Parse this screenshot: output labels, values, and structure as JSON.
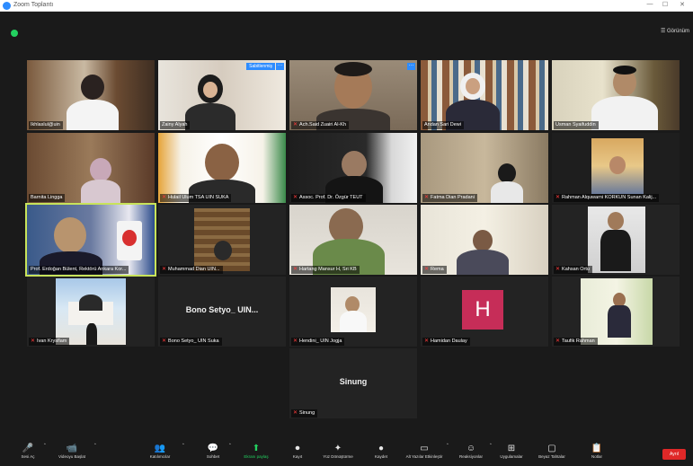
{
  "window": {
    "title": "Zoom Toplantı",
    "minimize": "—",
    "maximize": "☐",
    "close": "✕"
  },
  "header": {
    "view_label": "☰ Görünüm"
  },
  "tiles": [
    {
      "name": "Ikhlaslul@uin",
      "muted": false
    },
    {
      "name": "Zainy Alyah",
      "muted": false,
      "badge": "Sabitlenmiş"
    },
    {
      "name": "Ach.Said Zuairi Al-Kh",
      "muted": true
    },
    {
      "name": "Andan Sari Dewi",
      "muted": false
    },
    {
      "name": "Usman Syaifuddin",
      "muted": false
    },
    {
      "name": "Barnita Lingga",
      "muted": false
    },
    {
      "name": "Hulail Ulum TSA UIN SUKA",
      "muted": true
    },
    {
      "name": "Assoc. Prof. Dr. Özgür TEUT",
      "muted": true
    },
    {
      "name": "Fatma Dian Pradani",
      "muted": true
    },
    {
      "name": "Rahman Alquwarni KORKUN Sunan Kalij...",
      "muted": true
    },
    {
      "name": "Prof. Erdoğan Bülent, Rektörü Ankara Kor...",
      "muted": false
    },
    {
      "name": "Muhammad Dian UIN...",
      "muted": true
    },
    {
      "name": "Hartang Mansur H, Sri KB",
      "muted": true
    },
    {
      "name": "Rema",
      "muted": true
    },
    {
      "name": "Kahsan Ortu",
      "muted": true
    },
    {
      "name": "Ivan Krysflam",
      "muted": true
    },
    {
      "name": "Bono Setyo_ UIN Suka",
      "muted": true,
      "center_name": "Bono Setyo_ UIN..."
    },
    {
      "name": "Hendini_ UIN Jogja",
      "muted": true
    },
    {
      "name": "Hamidan Daulay",
      "muted": true,
      "avatar_letter": "H"
    },
    {
      "name": "Taufik Rahman",
      "muted": true
    },
    {
      "name": "Sinung",
      "muted": true,
      "center_name": "Sinung"
    }
  ],
  "toolbar": {
    "items": [
      {
        "label": "Sesi Aç",
        "icon": "🎤"
      },
      {
        "label": "Videoyu Başlat",
        "icon": "📹"
      },
      {
        "label": "Katılımcılar",
        "icon": "👥"
      },
      {
        "label": "Sohbet",
        "icon": "💬"
      },
      {
        "label": "Ekranı paylaş",
        "icon": "⬆"
      },
      {
        "label": "Kayıt",
        "icon": "⏺"
      },
      {
        "label": "Yüz Dönüştürme",
        "icon": "✦"
      },
      {
        "label": "Kaydet",
        "icon": "●"
      },
      {
        "label": "Alt Yazılar Etkinleştir",
        "icon": "▭"
      },
      {
        "label": "Reaksiyonlar",
        "icon": "☺"
      },
      {
        "label": "Uygulamalar",
        "icon": "⊞"
      },
      {
        "label": "Beyaz Tahtalar",
        "icon": "▢"
      },
      {
        "label": "Notlar",
        "icon": "📋"
      }
    ],
    "end_label": "Ayrıl"
  },
  "colors": {
    "background": "#1a1a1a",
    "tile": "#232323",
    "accent": "#2d8cff",
    "mic_muted": "#ff3b3b",
    "end": "#e02828",
    "active_speaker": "#c8e35a"
  }
}
